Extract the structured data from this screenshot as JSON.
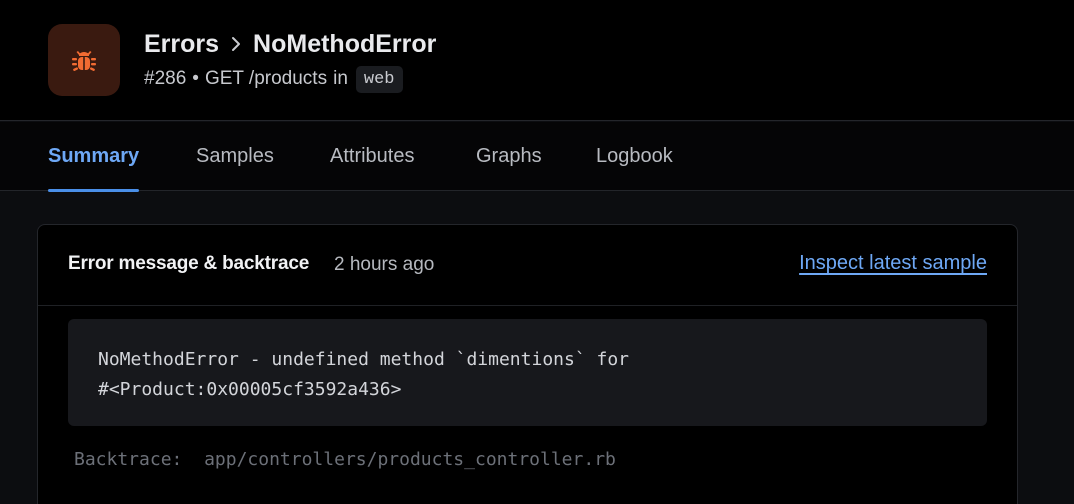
{
  "header": {
    "icon": "bug-icon",
    "icon_color": "#f26b32",
    "breadcrumb_parent": "Errors",
    "breadcrumb_current": "NoMethodError",
    "incident_number": "#286",
    "separator": "•",
    "action": "GET /products",
    "in_label": "in",
    "namespace": "web"
  },
  "tabs": [
    {
      "label": "Summary",
      "active": true
    },
    {
      "label": "Samples",
      "active": false
    },
    {
      "label": "Attributes",
      "active": false
    },
    {
      "label": "Graphs",
      "active": false
    },
    {
      "label": "Logbook",
      "active": false
    }
  ],
  "card": {
    "title": "Error message & backtrace",
    "time": "2 hours ago",
    "link": "Inspect latest sample",
    "message_line_1": "NoMethodError - undefined method `dimentions` for",
    "message_line_2": "#<Product:0x00005cf3592a436>",
    "backtrace_label": "Backtrace:",
    "backtrace_line": "app/controllers/products_controller.rb"
  },
  "colors": {
    "accent": "#6ea8f5",
    "background": "#0c0d10"
  }
}
